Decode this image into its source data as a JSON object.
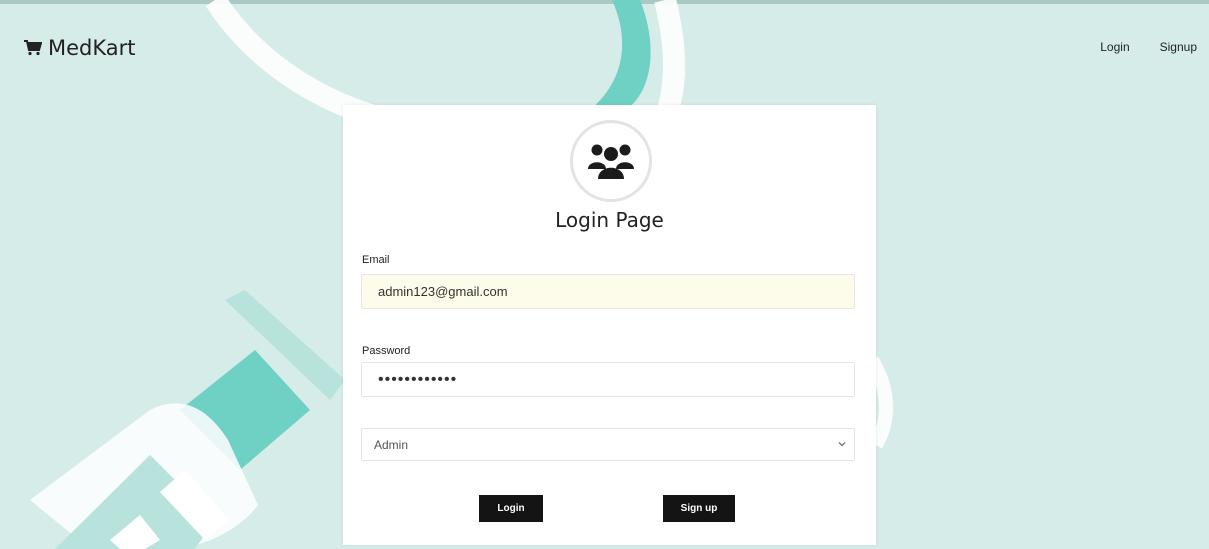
{
  "navbar": {
    "brand": "MedKart",
    "links": [
      "Login",
      "Signup"
    ]
  },
  "card": {
    "title": "Login Page",
    "email": {
      "label": "Email",
      "value": "admin123@gmail.com"
    },
    "password": {
      "label": "Password",
      "value": "adminpass123"
    },
    "role": {
      "selected": "Admin"
    },
    "buttons": {
      "login": "Login",
      "signup": "Sign up"
    }
  },
  "colors": {
    "background": "#d6ece9",
    "accent": "#6fd0c4",
    "button": "#141414"
  },
  "icons": {
    "brand": "cart-icon",
    "avatar": "users-icon",
    "select": "chevron-down-icon"
  }
}
